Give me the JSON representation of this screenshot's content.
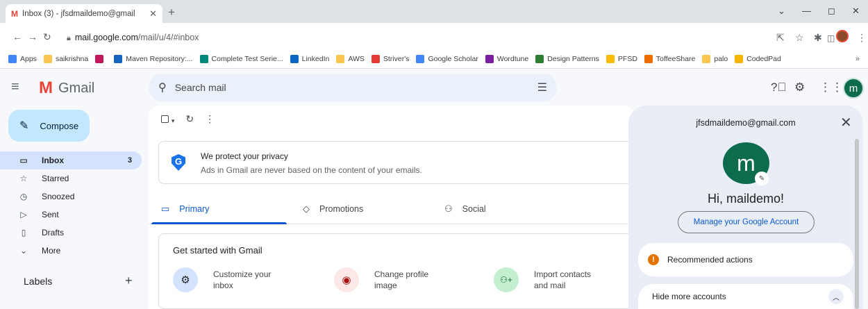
{
  "browser": {
    "tab_title": "Inbox (3) - jfsdmaildemo@gmail",
    "tab_favicon": "M",
    "url_domain": "mail.google.com",
    "url_path": "/mail/u/4/#inbox",
    "window_controls": [
      "⌄",
      "—",
      "◻",
      "✕"
    ],
    "bookmarks": [
      {
        "label": "Apps",
        "icon": "apps-grid-icon",
        "color": "#4285f4"
      },
      {
        "label": "saikrishna",
        "icon": "folder-icon",
        "color": "#f9c74f"
      },
      {
        "label": "",
        "icon": "p-logo-icon",
        "color": "#c2185b"
      },
      {
        "label": "Maven Repository:...",
        "icon": "maven-icon",
        "color": "#1565c0"
      },
      {
        "label": "Complete Test Serie...",
        "icon": "test-series-icon",
        "color": "#00897b"
      },
      {
        "label": "LinkedIn",
        "icon": "linkedin-icon",
        "color": "#0a66c2"
      },
      {
        "label": "AWS",
        "icon": "folder-icon",
        "color": "#f9c74f"
      },
      {
        "label": "Striver's",
        "icon": "striver-icon",
        "color": "#e53935"
      },
      {
        "label": "Google Scholar",
        "icon": "scholar-icon",
        "color": "#4285f4"
      },
      {
        "label": "Wordtune",
        "icon": "wordtune-icon",
        "color": "#7b1fa2"
      },
      {
        "label": "Design Patterns",
        "icon": "design-patterns-icon",
        "color": "#2e7d32"
      },
      {
        "label": "PFSD",
        "icon": "pfsd-icon",
        "color": "#fbbc04"
      },
      {
        "label": "ToffeeShare",
        "icon": "toffeeshare-icon",
        "color": "#ef6c00"
      },
      {
        "label": "palo",
        "icon": "folder-icon",
        "color": "#f9c74f"
      },
      {
        "label": "CodedPad",
        "icon": "codedpad-icon",
        "color": "#f4b400"
      }
    ],
    "bookmarks_more": "»"
  },
  "gmail": {
    "product_name": "Gmail",
    "search_placeholder": "Search mail",
    "compose_label": "Compose",
    "nav": [
      {
        "label": "Inbox",
        "icon": "inbox-icon",
        "glyph": "▭",
        "count": "3",
        "active": true
      },
      {
        "label": "Starred",
        "icon": "star-icon",
        "glyph": "☆",
        "count": "",
        "active": false
      },
      {
        "label": "Snoozed",
        "icon": "clock-icon",
        "glyph": "◷",
        "count": "",
        "active": false
      },
      {
        "label": "Sent",
        "icon": "send-icon",
        "glyph": "▷",
        "count": "",
        "active": false
      },
      {
        "label": "Drafts",
        "icon": "draft-icon",
        "glyph": "▯",
        "count": "",
        "active": false
      },
      {
        "label": "More",
        "icon": "chevron-down-icon",
        "glyph": "⌄",
        "count": "",
        "active": false
      }
    ],
    "labels_heading": "Labels",
    "privacy_title": "We protect your privacy",
    "privacy_subtitle": "Ads in Gmail are never based on the content of your emails.",
    "tabs": [
      {
        "label": "Primary",
        "icon": "inbox-icon",
        "glyph": "▭"
      },
      {
        "label": "Promotions",
        "icon": "tag-icon",
        "glyph": "◇"
      },
      {
        "label": "Social",
        "icon": "people-icon",
        "glyph": "⚇"
      }
    ],
    "get_started_title": "Get started with Gmail",
    "get_started_items": [
      {
        "line1": "Customize your",
        "line2": "inbox",
        "icon": "settings-icon",
        "glyph": "⚙",
        "bg": "#d3e3fd"
      },
      {
        "line1": "Change profile",
        "line2": "image",
        "icon": "profile-icon",
        "glyph": "◉",
        "bg": "#fce8e6"
      },
      {
        "line1": "Import contacts",
        "line2": "and mail",
        "icon": "add-person-icon",
        "glyph": "⚇+",
        "bg": "#c4eed0"
      }
    ]
  },
  "account": {
    "email": "jfsdmaildemo@gmail.com",
    "avatar_letter": "m",
    "greeting": "Hi, maildemo!",
    "manage_label": "Manage your Google Account",
    "recommended_label": "Recommended actions",
    "hide_accounts_label": "Hide more accounts",
    "avatar_color": "#0d6b4e"
  },
  "colors": {
    "accent_blue": "#0b57d0",
    "compose_bg": "#c2e7ff",
    "active_nav_bg": "#d3e3fd",
    "gmail_red": "#ea4335"
  }
}
